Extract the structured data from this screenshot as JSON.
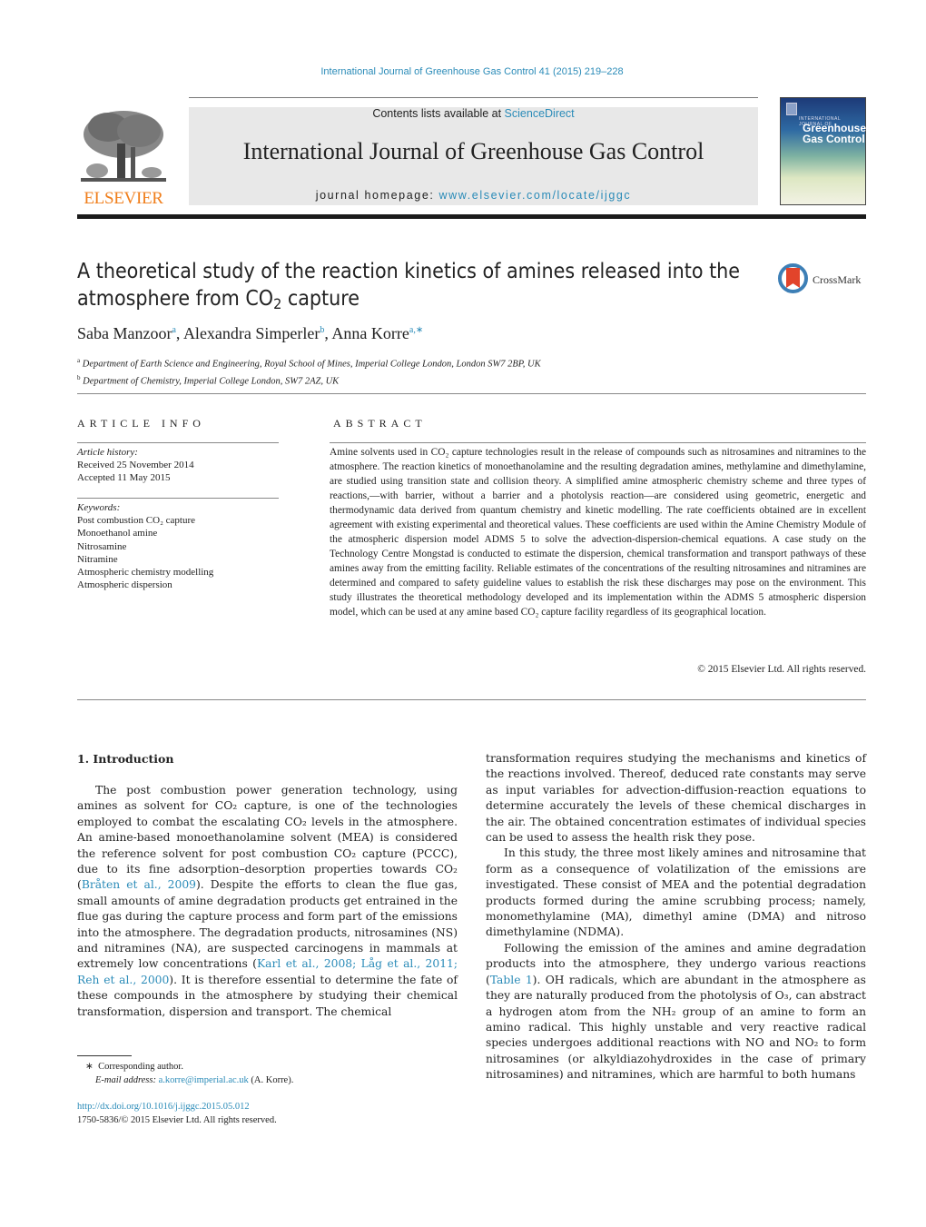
{
  "header": {
    "journal_ref": "International Journal of Greenhouse Gas Control 41 (2015) 219–228",
    "publisher_logo_text": "ELSEVIER",
    "contents_prefix": "Contents lists available at ",
    "contents_link": "ScienceDirect",
    "journal_title": "International Journal of Greenhouse Gas Control",
    "homepage_prefix": "journal homepage: ",
    "homepage_link": "www.elsevier.com/locate/ijggc",
    "cover": {
      "small_text": "INTERNATIONAL JOURNAL OF",
      "title_line1": "Greenhouse",
      "title_line2": "Gas Control"
    }
  },
  "article": {
    "title_part1": "A theoretical study of the reaction kinetics of amines released into the atmosphere from CO",
    "title_sub": "2",
    "title_part2": " capture",
    "crossmark_label": "CrossMark",
    "authors": [
      {
        "name": "Saba Manzoor",
        "sup": "a"
      },
      {
        "name": "Alexandra Simperler",
        "sup": "b"
      },
      {
        "name": "Anna Korre",
        "sup": "a,∗"
      }
    ],
    "affiliations": [
      {
        "sup": "a",
        "text": "Department of Earth Science and Engineering, Royal School of Mines, Imperial College London, London SW7 2BP, UK"
      },
      {
        "sup": "b",
        "text": "Department of Chemistry, Imperial College London, SW7 2AZ, UK"
      }
    ]
  },
  "article_info": {
    "heading": "ARTICLE INFO",
    "history_label": "Article history:",
    "received": "Received 25 November 2014",
    "accepted": "Accepted 11 May 2015",
    "keywords_label": "Keywords:",
    "keywords": [
      "Post combustion CO₂ capture",
      "Monoethanol amine",
      "Nitrosamine",
      "Nitramine",
      "Atmospheric chemistry modelling",
      "Atmospheric dispersion"
    ]
  },
  "abstract": {
    "heading": "ABSTRACT",
    "text": "Amine solvents used in CO₂ capture technologies result in the release of compounds such as nitrosamines and nitramines to the atmosphere. The reaction kinetics of monoethanolamine and the resulting degradation amines, methylamine and dimethylamine, are studied using transition state and collision theory. A simplified amine atmospheric chemistry scheme and three types of reactions,—with barrier, without a barrier and a photolysis reaction—are considered using geometric, energetic and thermodynamic data derived from quantum chemistry and kinetic modelling. The rate coefficients obtained are in excellent agreement with existing experimental and theoretical values. These coefficients are used within the Amine Chemistry Module of the atmospheric dispersion model ADMS 5 to solve the advection-dispersion-chemical equations. A case study on the Technology Centre Mongstad is conducted to estimate the dispersion, chemical transformation and transport pathways of these amines away from the emitting facility. Reliable estimates of the concentrations of the resulting nitrosamines and nitramines are determined and compared to safety guideline values to establish the risk these discharges may pose on the environment. This study illustrates the theoretical methodology developed and its implementation within the ADMS 5 atmospheric dispersion model, which can be used at any amine based CO₂ capture facility regardless of its geographical location.",
    "copyright": "© 2015 Elsevier Ltd. All rights reserved."
  },
  "introduction": {
    "heading": "1.  Introduction",
    "left_p1_a": "The post combustion power generation technology, using amines as solvent for CO₂ capture, is one of the technologies employed to combat the escalating CO₂ levels in the atmosphere. An amine-based monoethanolamine solvent (MEA) is considered the reference solvent for post combustion CO₂ capture (PCCC), due to its fine adsorption–desorption properties towards CO₂ (",
    "left_p1_cite1": "Bråten et al., 2009",
    "left_p1_b": "). Despite the efforts to clean the flue gas, small amounts of amine degradation products get entrained in the flue gas during the capture process and form part of the emissions into the atmosphere. The degradation products, nitrosamines (NS) and nitramines (NA), are suspected carcinogens in mammals at extremely low concentrations (",
    "left_p1_cite2": "Karl et al., 2008; Låg et al., 2011; Reh et al., 2000",
    "left_p1_c": "). It is therefore essential to determine the fate of these compounds in the atmosphere by studying their chemical transformation, dispersion and transport. The chemical",
    "right_p1": "transformation requires studying the mechanisms and kinetics of the reactions involved. Thereof, deduced rate constants may serve as input variables for advection-diffusion-reaction equations to determine accurately the levels of these chemical discharges in the air. The obtained concentration estimates of individual species can be used to assess the health risk they pose.",
    "right_p2": "In this study, the three most likely amines and nitrosamine that form as a consequence of volatilization of the emissions are investigated. These consist of MEA and the potential degradation products formed during the amine scrubbing process; namely, monomethylamine (MA), dimethyl amine (DMA) and nitroso dimethylamine (NDMA).",
    "right_p3_a": "Following the emission of the amines and amine degradation products into the atmosphere, they undergo various reactions (",
    "right_p3_cite": "Table 1",
    "right_p3_b": "). OH radicals, which are abundant in the atmosphere as they are naturally produced from the photolysis of O₃, can abstract a hydrogen atom from the NH₂ group of an amine to form an amino radical. This highly unstable and very reactive radical species undergoes additional reactions with NO and NO₂ to form nitrosamines (or alkyldiazohydroxides in the case of primary nitrosamines) and nitramines, which are harmful to both humans"
  },
  "footnotes": {
    "corresponding_mark": "∗",
    "corresponding_text": "Corresponding author.",
    "email_label": "E-mail address:",
    "email": "a.korre@imperial.ac.uk",
    "email_suffix": "(A. Korre).",
    "doi": "http://dx.doi.org/10.1016/j.ijggc.2015.05.012",
    "issn_line": "1750-5836/© 2015 Elsevier Ltd. All rights reserved."
  }
}
